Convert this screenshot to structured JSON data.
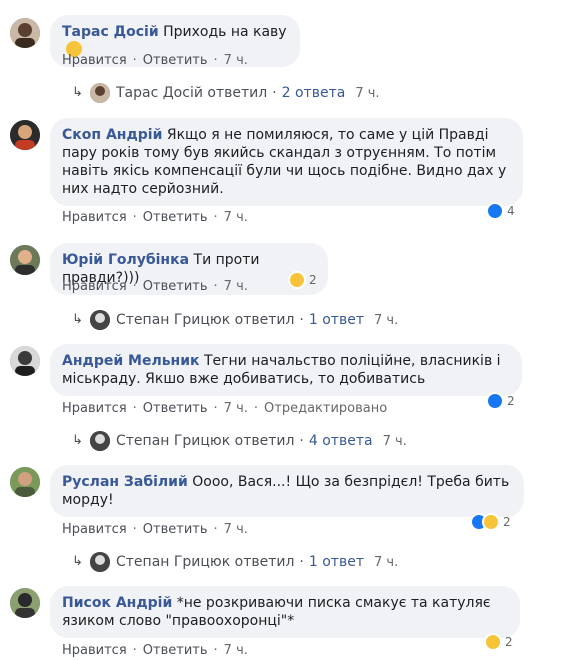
{
  "labels": {
    "like": "Нравится",
    "reply": "Ответить",
    "edited": "Отредактировано"
  },
  "comments": [
    {
      "author": "Тарас Досій",
      "text": "Приходь на каву",
      "time": "7 ч.",
      "replies": {
        "name": "Тарас Досій ответил",
        "count": "2 ответа",
        "time": "7 ч."
      }
    },
    {
      "author": "Скоп Андрій",
      "text": "Якщо я не помиляюся, то саме у цій Правді пару років тому був якийсь скандал з отруєнням. То потім навіть якісь компенсації були чи щось подібне. Видно дах у них надто серйозний.",
      "time": "7 ч.",
      "reaction_count": "4"
    },
    {
      "author": "Юрій Голубінка",
      "text": "Ти проти правди?)))",
      "time": "7 ч.",
      "reaction_count": "2",
      "replies": {
        "name": "Степан Грицюк ответил",
        "count": "1 ответ",
        "time": "7 ч."
      }
    },
    {
      "author": "Андрей Мельник",
      "text": "Тегни начальство поліційне, власників і міськраду. Якшо вже добиватись, то добиватись",
      "time": "7 ч.",
      "reaction_count": "2",
      "replies": {
        "name": "Степан Грицюк ответил",
        "count": "4 ответа",
        "time": "7 ч."
      }
    },
    {
      "author": "Руслан Забілий",
      "text": "Оооо, Вася...! Що за безпрідєл! Треба бить морду!",
      "time": "7 ч.",
      "reaction_count": "2",
      "replies": {
        "name": "Степан Грицюк ответил",
        "count": "1 ответ",
        "time": "7 ч."
      }
    },
    {
      "author": "Писок Андрій",
      "text": "*не розкриваючи писка смакує та катуляє язиком слово \"правоохоронці\"*",
      "time": "7 ч.",
      "reaction_count": "2"
    }
  ]
}
